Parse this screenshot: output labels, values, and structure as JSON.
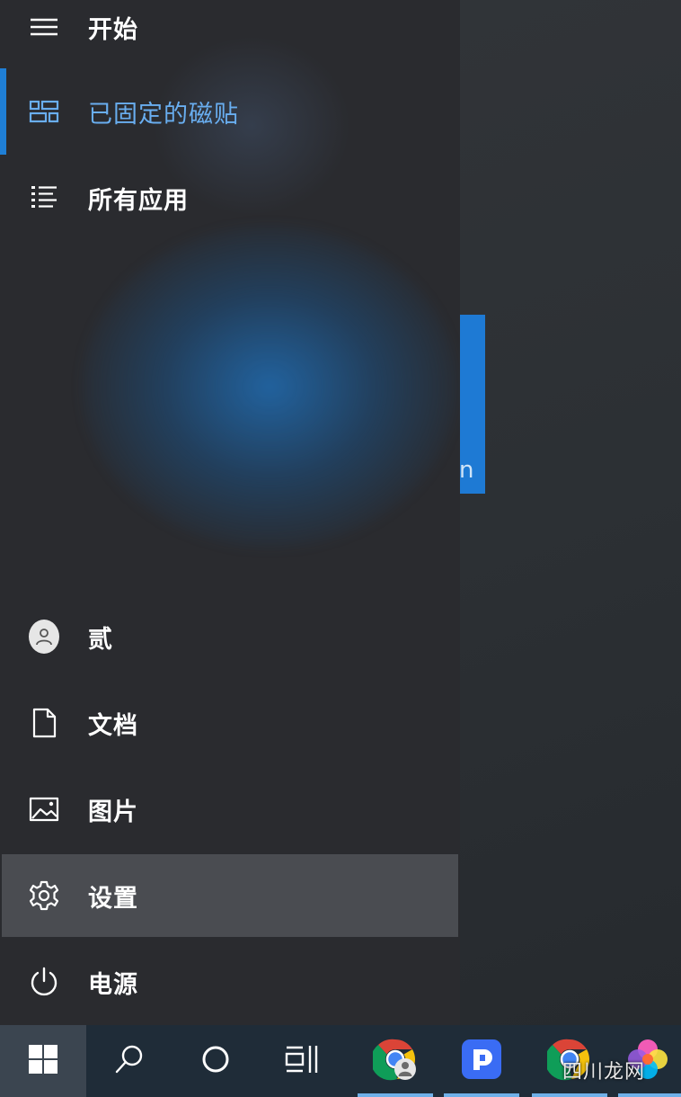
{
  "start_menu": {
    "title": "开始",
    "top_items": [
      {
        "label": "已固定的磁贴",
        "icon": "pinned-tiles-icon",
        "active": true
      },
      {
        "label": "所有应用",
        "icon": "all-apps-list-icon"
      }
    ],
    "bottom_items": [
      {
        "label": "贰",
        "icon": "user-avatar-icon"
      },
      {
        "label": "文档",
        "icon": "document-icon"
      },
      {
        "label": "图片",
        "icon": "pictures-icon"
      },
      {
        "label": "设置",
        "icon": "gear-icon",
        "hovered": true
      },
      {
        "label": "电源",
        "icon": "power-icon"
      }
    ]
  },
  "taskbar": {
    "items": [
      {
        "icon": "windows-logo-icon"
      },
      {
        "icon": "search-icon"
      },
      {
        "icon": "cortana-circle-icon"
      },
      {
        "icon": "task-view-icon"
      },
      {
        "icon": "chrome-profile-icon"
      },
      {
        "icon": "blue-app-icon"
      },
      {
        "icon": "chrome-icon"
      },
      {
        "icon": "colorful-app-icon"
      }
    ]
  },
  "background": {
    "tile_glyph": "n"
  },
  "watermark": "四川龙网",
  "colors": {
    "accent": "#1f7fd6",
    "active_text": "#69aef0",
    "menu_bg": "#2a2b2f",
    "hover_bg": "#4a4c51",
    "taskbar_bg": "#1f2c38"
  }
}
